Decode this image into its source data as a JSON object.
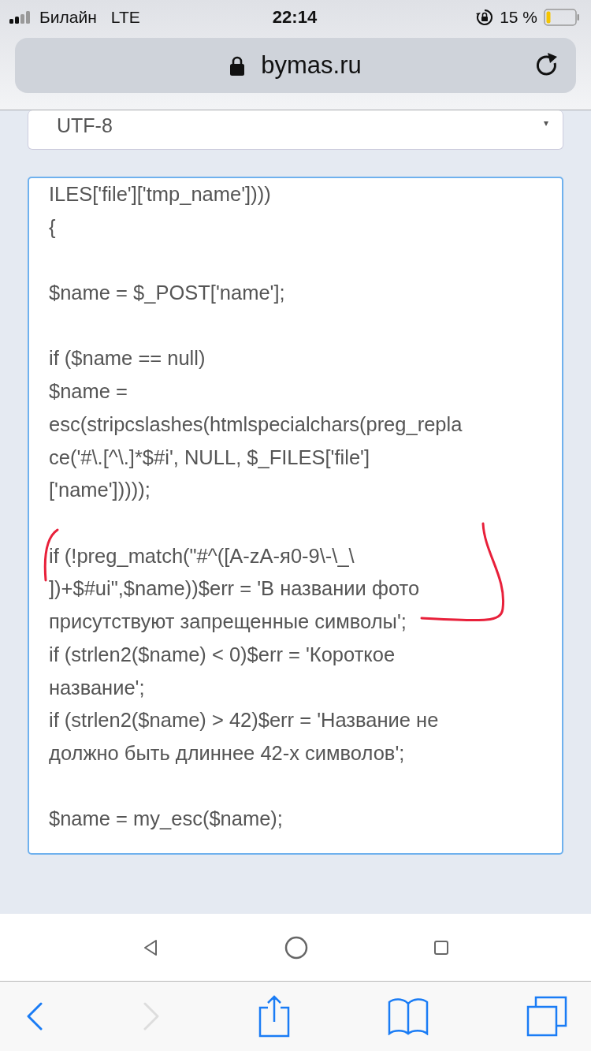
{
  "status_bar": {
    "carrier": "Билайн",
    "network": "LTE",
    "time": "22:14",
    "battery": "15 %"
  },
  "address_bar": {
    "url": "bymas.ru"
  },
  "encoding_select": {
    "value": "UTF-8"
  },
  "code_blocks": [
    [
      "ILES['file']['tmp_name'])))",
      "{"
    ],
    [
      "$name = $_POST['name'];"
    ],
    [
      "if ($name == null)",
      "$name =",
      "esc(stripcslashes(htmlspecialchars(preg_repla",
      "ce('#\\.[^\\.]*$#i', NULL, $_FILES['file']",
      "['name']))));"
    ],
    [
      "if (!preg_match(\"#^([A-zA-я0-9\\-\\_\\",
      "])+$#ui\",$name))$err = 'В названии фото",
      "присутствуют запрещенные символы';",
      "if (strlen2($name) < 0)$err = 'Короткое",
      "название';",
      "if (strlen2($name) > 42)$err = 'Название не",
      "должно быть длиннее 42-х символов';"
    ],
    [
      "$name = my_esc($name);"
    ]
  ],
  "toolbar": {
    "back_disabled": false,
    "forward_disabled": true
  }
}
